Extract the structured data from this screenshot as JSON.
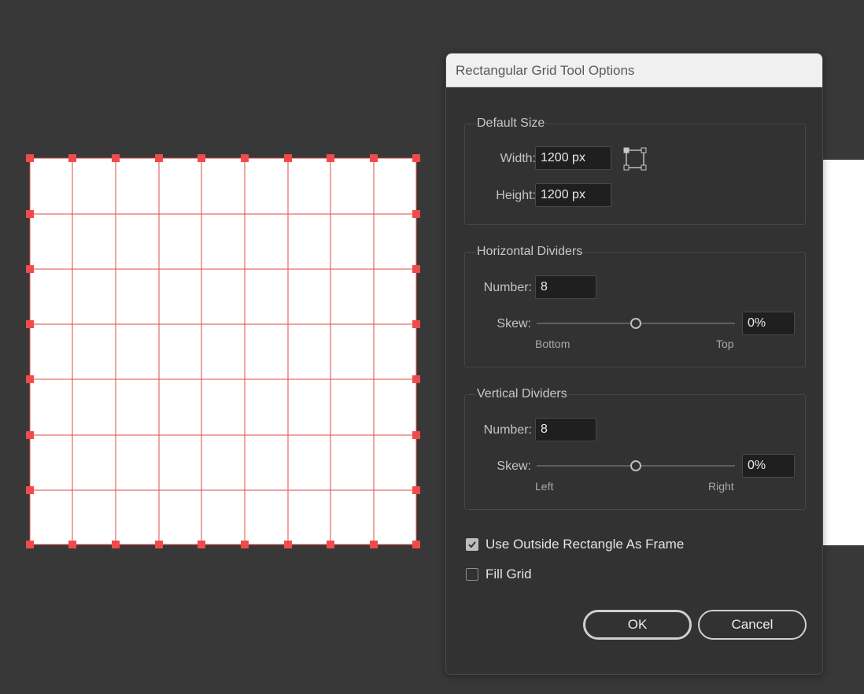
{
  "dialog": {
    "title": "Rectangular Grid Tool Options",
    "default_size": {
      "legend": "Default Size",
      "width_label": "Width:",
      "width_value": "1200 px",
      "height_label": "Height:",
      "height_value": "1200 px"
    },
    "horizontal_dividers": {
      "legend": "Horizontal Dividers",
      "number_label": "Number:",
      "number_value": "8",
      "skew_label": "Skew:",
      "skew_value": "0%",
      "skew_min_label": "Bottom",
      "skew_max_label": "Top",
      "skew_position": 0.5
    },
    "vertical_dividers": {
      "legend": "Vertical Dividers",
      "number_label": "Number:",
      "number_value": "8",
      "skew_label": "Skew:",
      "skew_value": "0%",
      "skew_min_label": "Left",
      "skew_max_label": "Right",
      "skew_position": 0.5
    },
    "options": {
      "use_outside_rect_label": "Use Outside Rectangle As Frame",
      "use_outside_rect_checked": true,
      "fill_grid_label": "Fill Grid",
      "fill_grid_checked": false
    },
    "buttons": {
      "ok": "OK",
      "cancel": "Cancel"
    }
  },
  "canvas": {
    "background_color": "#383838",
    "grid_fill_color": "#ffffff",
    "grid_line_color": "#e04848",
    "anchor_color": "#f04b4b"
  }
}
